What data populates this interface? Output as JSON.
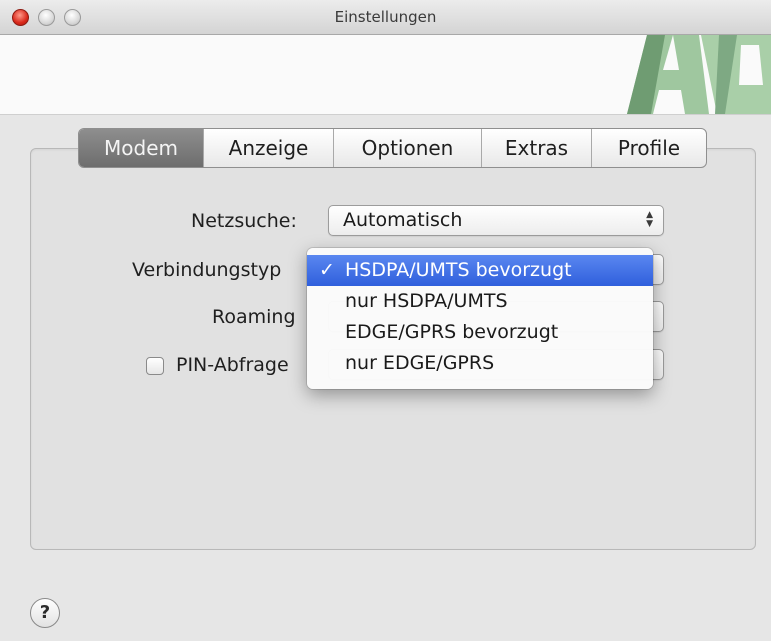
{
  "window": {
    "title": "Einstellungen"
  },
  "tabs": [
    {
      "label": "Modem",
      "active": true
    },
    {
      "label": "Anzeige",
      "active": false
    },
    {
      "label": "Optionen",
      "active": false
    },
    {
      "label": "Extras",
      "active": false
    },
    {
      "label": "Profile",
      "active": false
    }
  ],
  "form": {
    "netzsuche": {
      "label": "Netzsuche:",
      "value": "Automatisch"
    },
    "verbindungstyp": {
      "label": "Verbindungstyp"
    },
    "roaming": {
      "label": "Roaming"
    },
    "pin": {
      "label": "PIN-Abfrage",
      "checked": false
    }
  },
  "menu": {
    "check_mark": "✓",
    "items": [
      {
        "label": "HSDPA/UMTS bevorzugt",
        "selected": true
      },
      {
        "label": "nur HSDPA/UMTS",
        "selected": false
      },
      {
        "label": "EDGE/GPRS bevorzugt",
        "selected": false
      },
      {
        "label": "nur EDGE/GPRS",
        "selected": false
      }
    ]
  },
  "help": {
    "label": "?"
  },
  "icons": {
    "popup_arrows": "updown-arrows-icon",
    "logo": "application-logo-icon"
  },
  "colors": {
    "selection": "#2f5fdc",
    "active_tab": "#7a7a7a",
    "close_button": "#d9281a"
  }
}
